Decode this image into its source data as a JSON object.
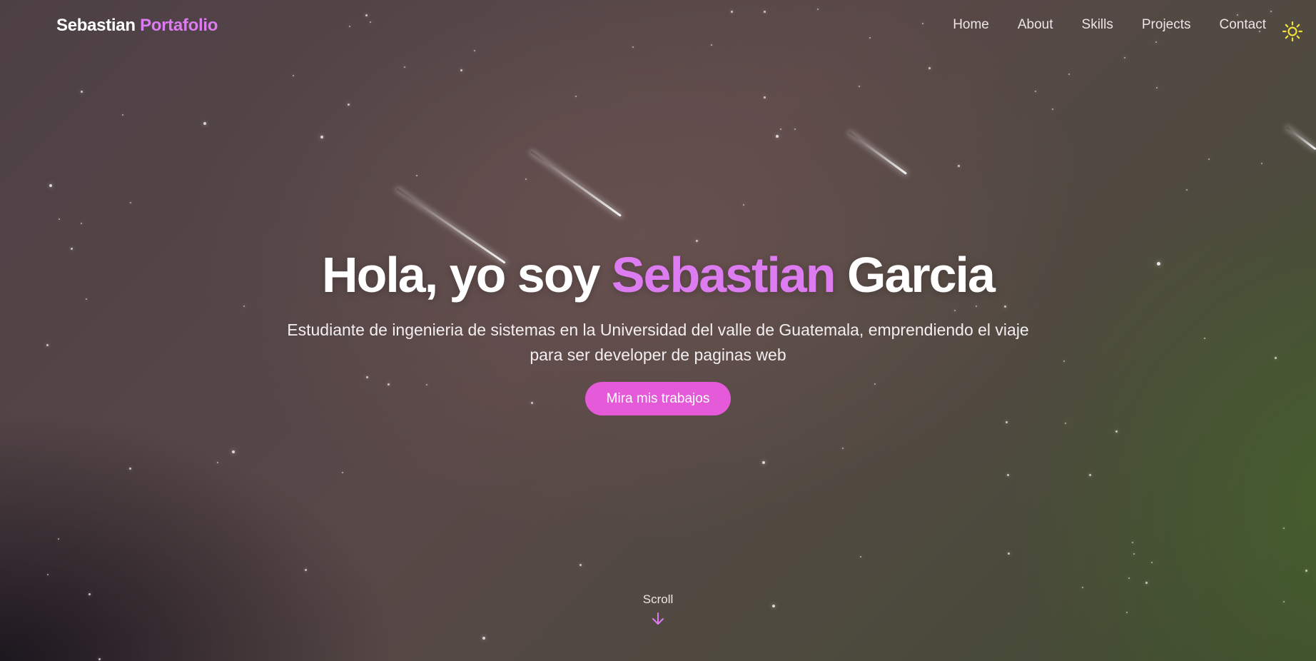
{
  "brand": {
    "first": "Sebastian",
    "accent": "Portafolio"
  },
  "nav": {
    "links": [
      "Home",
      "About",
      "Skills",
      "Projects",
      "Contact"
    ],
    "theme_toggle_icon": "sun-icon"
  },
  "hero": {
    "title_prefix": "Hola, yo soy",
    "title_accent": "Sebastian",
    "title_suffix": "Garcia",
    "subtitle": "Estudiante de ingenieria de sistemas en la Universidad del valle de Guatemala, emprendiendo el viaje para ser developer de paginas web",
    "cta_label": "Mira mis trabajos"
  },
  "scroll": {
    "label": "Scroll",
    "icon": "arrow-down-icon"
  },
  "colors": {
    "accent": "#dd7cf0",
    "button": "#e55ad9",
    "sun": "#f3e03b"
  }
}
